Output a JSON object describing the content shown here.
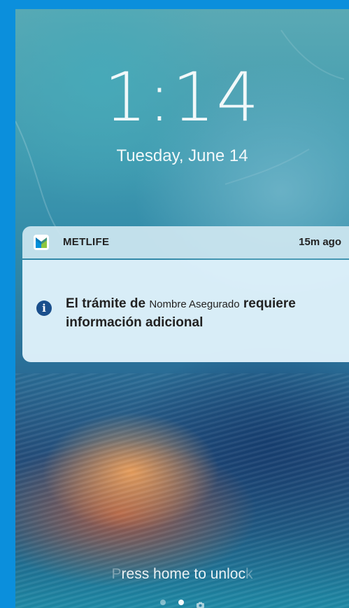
{
  "lockscreen": {
    "time": "1:14",
    "date": "Tuesday, June 14",
    "unlock_prefix": "P",
    "unlock_text": "ress home to unloc",
    "unlock_suffix": "k"
  },
  "notification": {
    "app_name": "METLIFE",
    "time_ago": "15m ago",
    "message_part1": "El trámite de ",
    "message_name": "Nombre Asegurado",
    "message_part2": " requiere información adicional",
    "icon": "info-icon",
    "app_icon": "metlife-logo-icon"
  },
  "colors": {
    "frame": "#0b8fdc",
    "info_icon": "#1a4f8c",
    "logo_green": "#8dc63f",
    "logo_blue": "#0090da"
  }
}
